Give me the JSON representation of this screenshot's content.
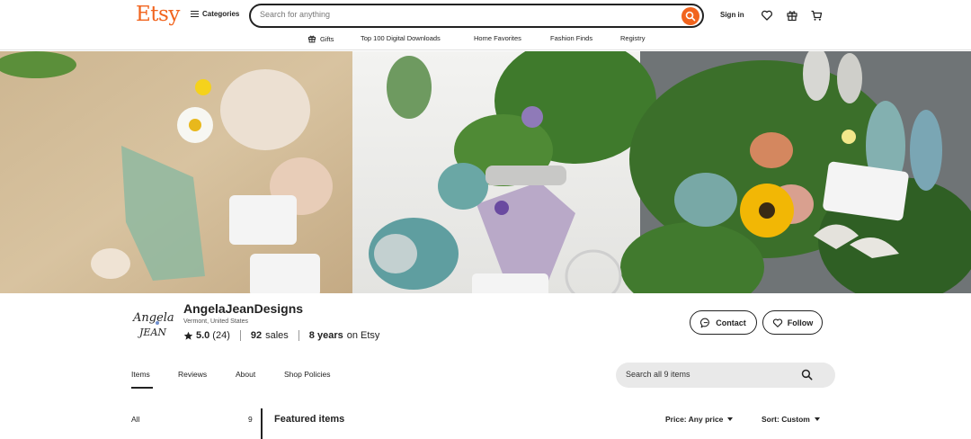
{
  "header": {
    "logo": "Etsy",
    "categories_label": "Categories",
    "search_placeholder": "Search for anything",
    "signin_label": "Sign in"
  },
  "nav": {
    "items": [
      "Gifts",
      "Top 100 Digital Downloads",
      "Home Favorites",
      "Fashion Finds",
      "Registry"
    ]
  },
  "shop": {
    "name": "AngelaJeanDesigns",
    "location": "Vermont, United States",
    "rating": "5.0",
    "reviews": "(24)",
    "sales_count": "92",
    "sales_label": "sales",
    "years": "8 years",
    "years_suffix": "on Etsy",
    "logo_text_1": "Angela",
    "logo_text_2": "JEAN",
    "contact_label": "Contact",
    "follow_label": "Follow"
  },
  "tabs": {
    "items": [
      "Items",
      "Reviews",
      "About",
      "Shop Policies"
    ],
    "active": "Items",
    "search_placeholder": "Search all 9 items"
  },
  "listing": {
    "section_label": "All",
    "section_count": "9",
    "featured_title": "Featured items",
    "price_filter": "Price: Any price",
    "sort_filter": "Sort: Custom"
  },
  "colors": {
    "brand": "#f1641e"
  }
}
